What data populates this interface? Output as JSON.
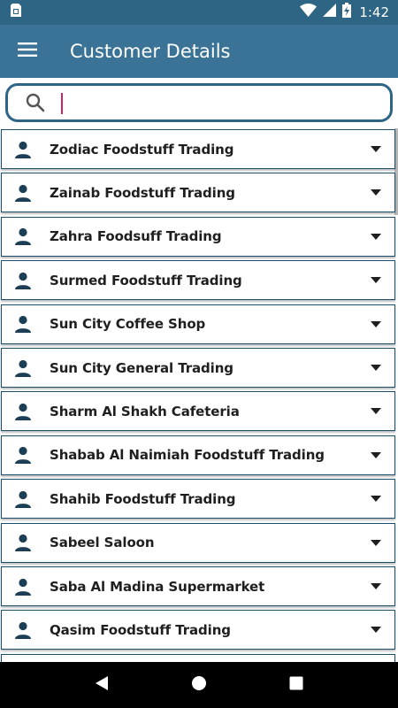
{
  "status_bar": {
    "time": "1:42",
    "icons": [
      "sim-card-icon",
      "wifi-icon",
      "signal-icon",
      "battery-charging-icon"
    ]
  },
  "app_bar": {
    "title": "Customer Details",
    "menu_icon": "menu-icon"
  },
  "search": {
    "placeholder": "",
    "value": "",
    "icon": "search-icon"
  },
  "customers": [
    {
      "name": "Zodiac Foodstuff Trading"
    },
    {
      "name": "Zainab Foodstuff Trading"
    },
    {
      "name": "Zahra Foodsuff Trading"
    },
    {
      "name": "Surmed Foodstuff Trading"
    },
    {
      "name": "Sun City Coffee Shop"
    },
    {
      "name": "Sun City General Trading"
    },
    {
      "name": "Sharm Al Shakh Cafeteria"
    },
    {
      "name": "Shabab Al Naimiah Foodstuff Trading"
    },
    {
      "name": "Shahib Foodstuff Trading"
    },
    {
      "name": "Sabeel Saloon"
    },
    {
      "name": "Saba Al Madina Supermarket"
    },
    {
      "name": "Qasim Foodstuff Trading"
    },
    {
      "name": ""
    }
  ],
  "nav_bar": {
    "icons": [
      "back-icon",
      "home-icon",
      "recents-icon"
    ]
  },
  "colors": {
    "status_bar": "#2e6585",
    "app_bar": "#3b7396",
    "accent_caret": "#d1245f",
    "item_border": "#1b4f6e",
    "icon_dark": "#1d3f56"
  }
}
